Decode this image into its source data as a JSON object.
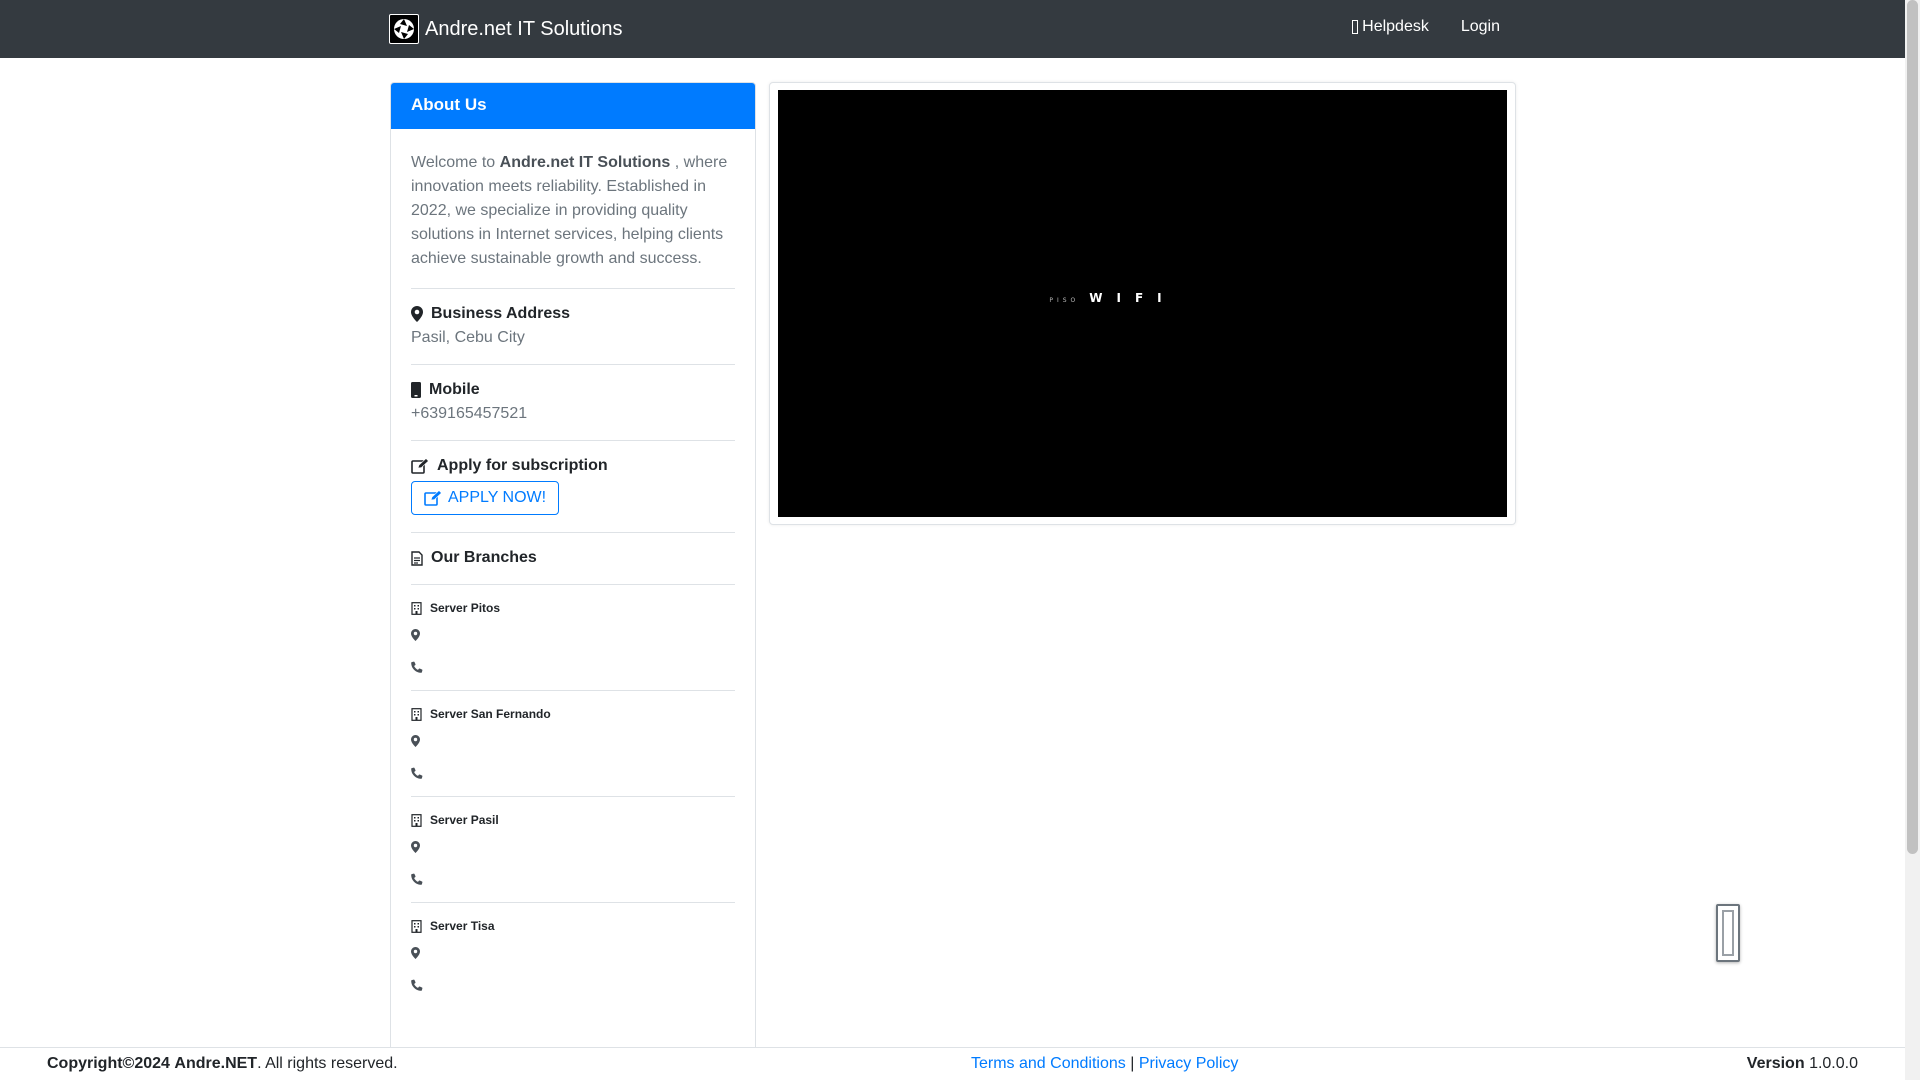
{
  "navbar": {
    "brand": "Andre.net IT Solutions",
    "links": [
      {
        "label": "Helpdesk",
        "icon": "glyph-icon"
      },
      {
        "label": "Login"
      }
    ]
  },
  "about": {
    "title": "About Us",
    "welcome_prefix": "Welcome to",
    "company_name": "Andre.net IT Solutions",
    "welcome_suffix": ", where innovation meets reliability. Established in 2022, we specialize in providing quality solutions in Internet services, helping clients achieve sustainable growth and success.",
    "address_label": "Business Address",
    "address_value": "Pasil, Cebu City",
    "mobile_label": "Mobile",
    "mobile_value": "+639165457521",
    "apply_label": "Apply for subscription",
    "apply_button": "APPLY NOW!",
    "branches_label": "Our Branches",
    "branches": [
      {
        "name": "Server Pitos"
      },
      {
        "name": "Server San Fernando"
      },
      {
        "name": "Server Pasil"
      },
      {
        "name": "Server Tisa"
      }
    ]
  },
  "video": {
    "small_text": "PISO",
    "big_text": "WIFI"
  },
  "footer": {
    "copyright_prefix": "Copyright©2024",
    "company_link": "Andre.NET",
    "rights": ". All rights reserved.",
    "terms": "Terms and Conditions",
    "separator": "|",
    "privacy": "Privacy Policy",
    "version_label": "Version",
    "version_value": "1.0.0.0"
  },
  "colors": {
    "navbar": "#343a40",
    "primary": "#007bff",
    "muted_text": "#6c757d"
  }
}
